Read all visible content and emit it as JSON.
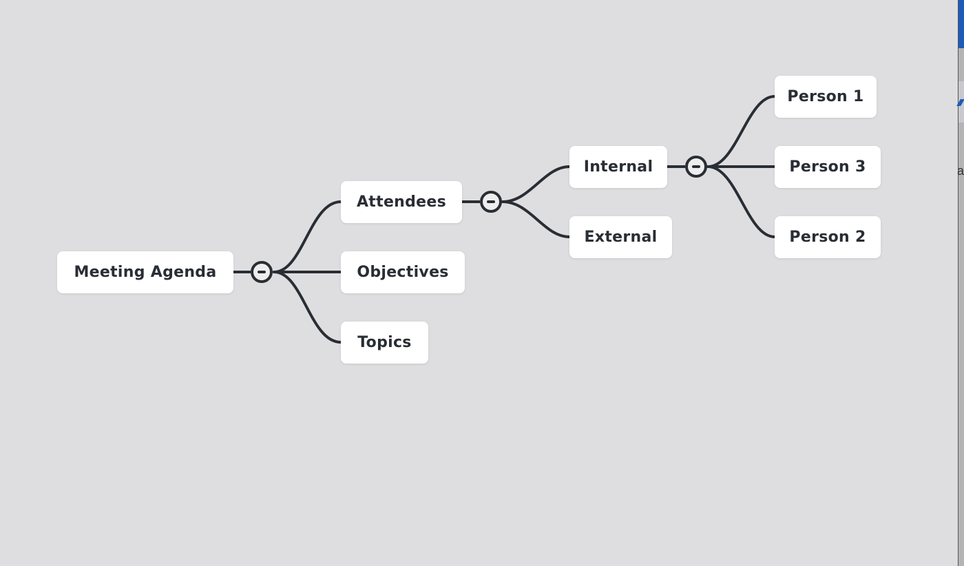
{
  "mindmap": {
    "root": {
      "id": "root",
      "label": "Meeting Agenda"
    },
    "nodes": [
      {
        "id": "attendees",
        "label": "Attendees",
        "parent": "root"
      },
      {
        "id": "objectives",
        "label": "Objectives",
        "parent": "root"
      },
      {
        "id": "topics",
        "label": "Topics",
        "parent": "root"
      },
      {
        "id": "internal",
        "label": "Internal",
        "parent": "attendees"
      },
      {
        "id": "external",
        "label": "External",
        "parent": "attendees"
      },
      {
        "id": "person1",
        "label": "Person 1",
        "parent": "internal"
      },
      {
        "id": "person3",
        "label": "Person 3",
        "parent": "internal"
      },
      {
        "id": "person2",
        "label": "Person 2",
        "parent": "internal"
      }
    ],
    "collapse_toggles": [
      {
        "node": "root",
        "icon": "collapse-minus-icon",
        "state": "expanded"
      },
      {
        "node": "attendees",
        "icon": "collapse-minus-icon",
        "state": "expanded"
      },
      {
        "node": "internal",
        "icon": "collapse-minus-icon",
        "state": "expanded"
      }
    ]
  },
  "colors": {
    "canvas_bg": "#eeeeee",
    "grid_dot": "#dedee0",
    "node_bg": "#ffffff",
    "line": "#292d34",
    "text": "#292d34"
  },
  "side_window": {
    "partial_text": "a"
  }
}
